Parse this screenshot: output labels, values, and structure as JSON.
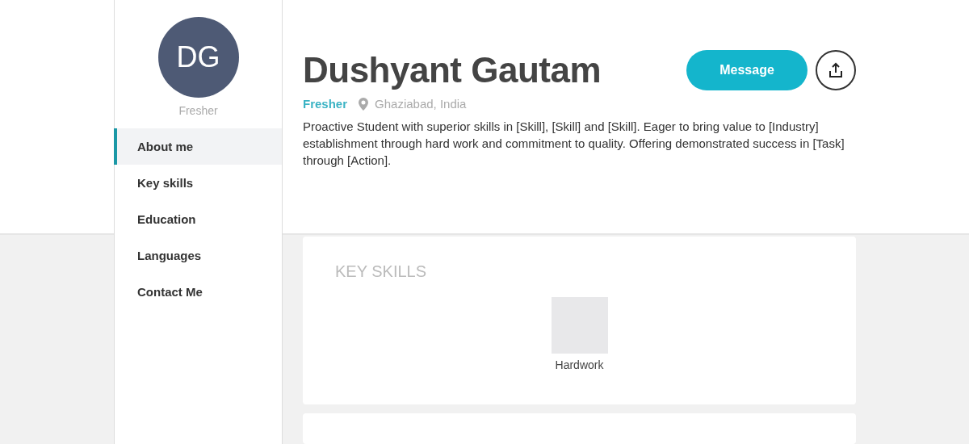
{
  "profile": {
    "initials": "DG",
    "subtitle": "Fresher"
  },
  "nav": [
    {
      "label": "About me",
      "selected": true
    },
    {
      "label": "Key skills",
      "selected": false
    },
    {
      "label": "Education",
      "selected": false
    },
    {
      "label": "Languages",
      "selected": false
    },
    {
      "label": "Contact Me",
      "selected": false
    }
  ],
  "header": {
    "name": "Dushyant Gautam",
    "level": "Fresher",
    "location": "Ghaziabad, India",
    "summary": "Proactive Student with superior skills in [Skill], [Skill] and [Skill]. Eager to bring value to [Industry] establishment through hard work and commitment to quality. Offering demonstrated success in [Task] through [Action].",
    "message_button": "Message"
  },
  "key_skills": {
    "title": "KEY SKILLS",
    "items": [
      {
        "label": "Hardwork"
      }
    ]
  }
}
